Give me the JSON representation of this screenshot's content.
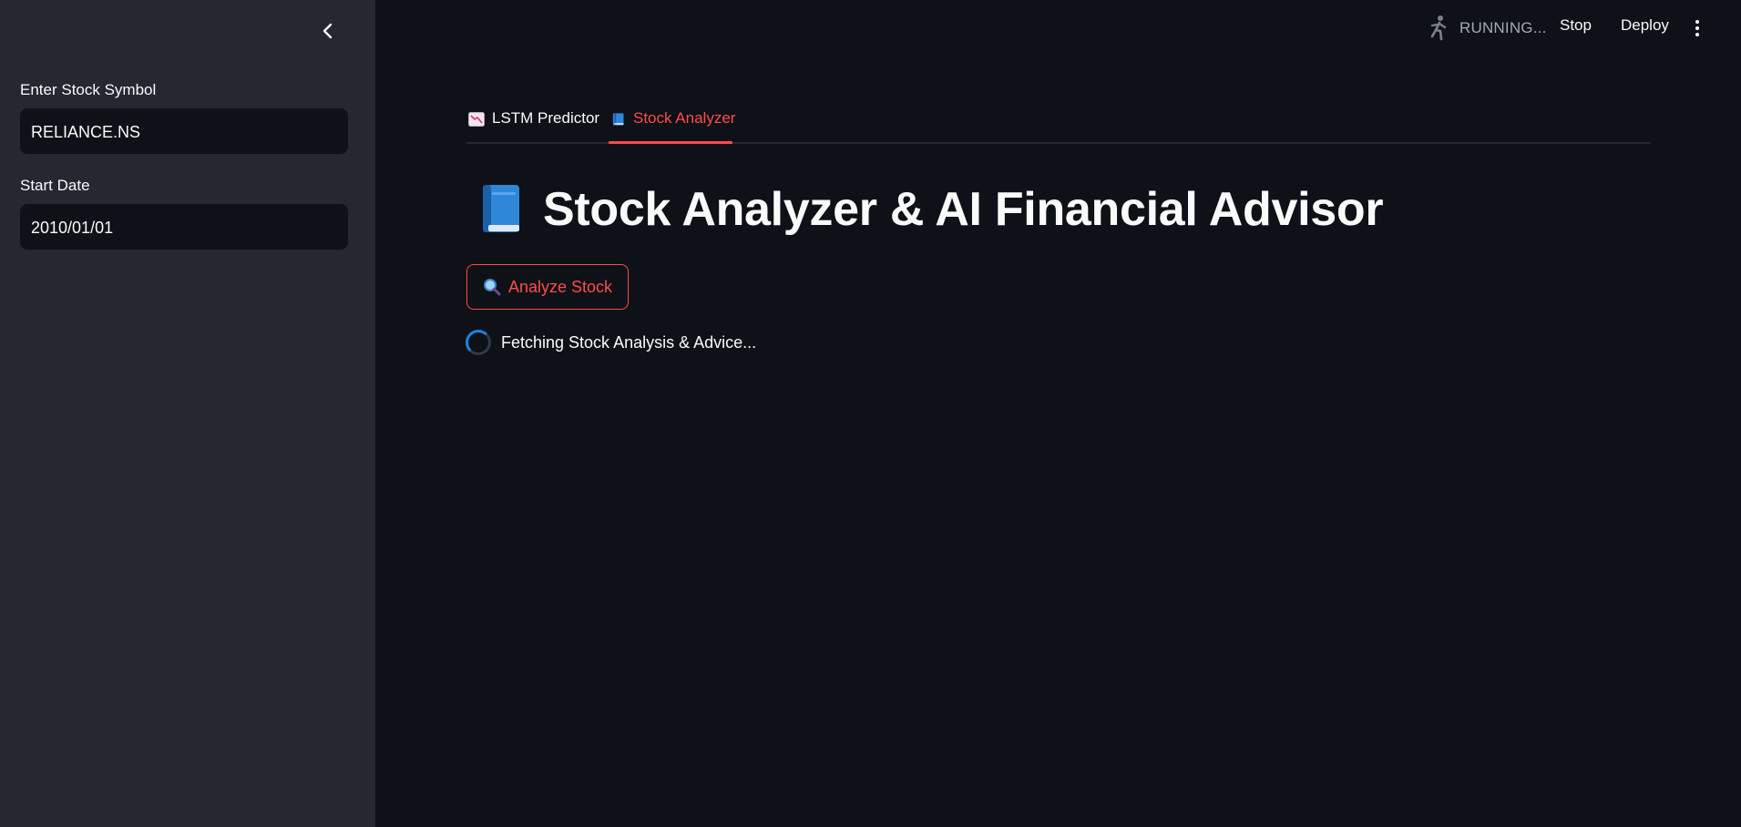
{
  "sidebar": {
    "symbol_label": "Enter Stock Symbol",
    "symbol_value": "RELIANCE.NS",
    "start_date_label": "Start Date",
    "start_date_value": "2010/01/01"
  },
  "toolbar": {
    "status": "RUNNING...",
    "stop_label": "Stop",
    "deploy_label": "Deploy"
  },
  "tabs": [
    {
      "label": "LSTM Predictor",
      "icon": "chart-decreasing-icon",
      "active": false
    },
    {
      "label": "Stock Analyzer",
      "icon": "blue-book-icon",
      "active": true
    }
  ],
  "main": {
    "title": "Stock Analyzer & AI Financial Advisor",
    "title_icon": "blue-book-icon",
    "analyze_button": "Analyze Stock",
    "analyze_icon": "magnifying-glass-icon",
    "spinner_text": "Fetching Stock Analysis & Advice..."
  },
  "colors": {
    "accent": "#ff4b4b",
    "background": "#0e1117",
    "sidebar": "#262730",
    "spinner": "#1c83e1"
  }
}
